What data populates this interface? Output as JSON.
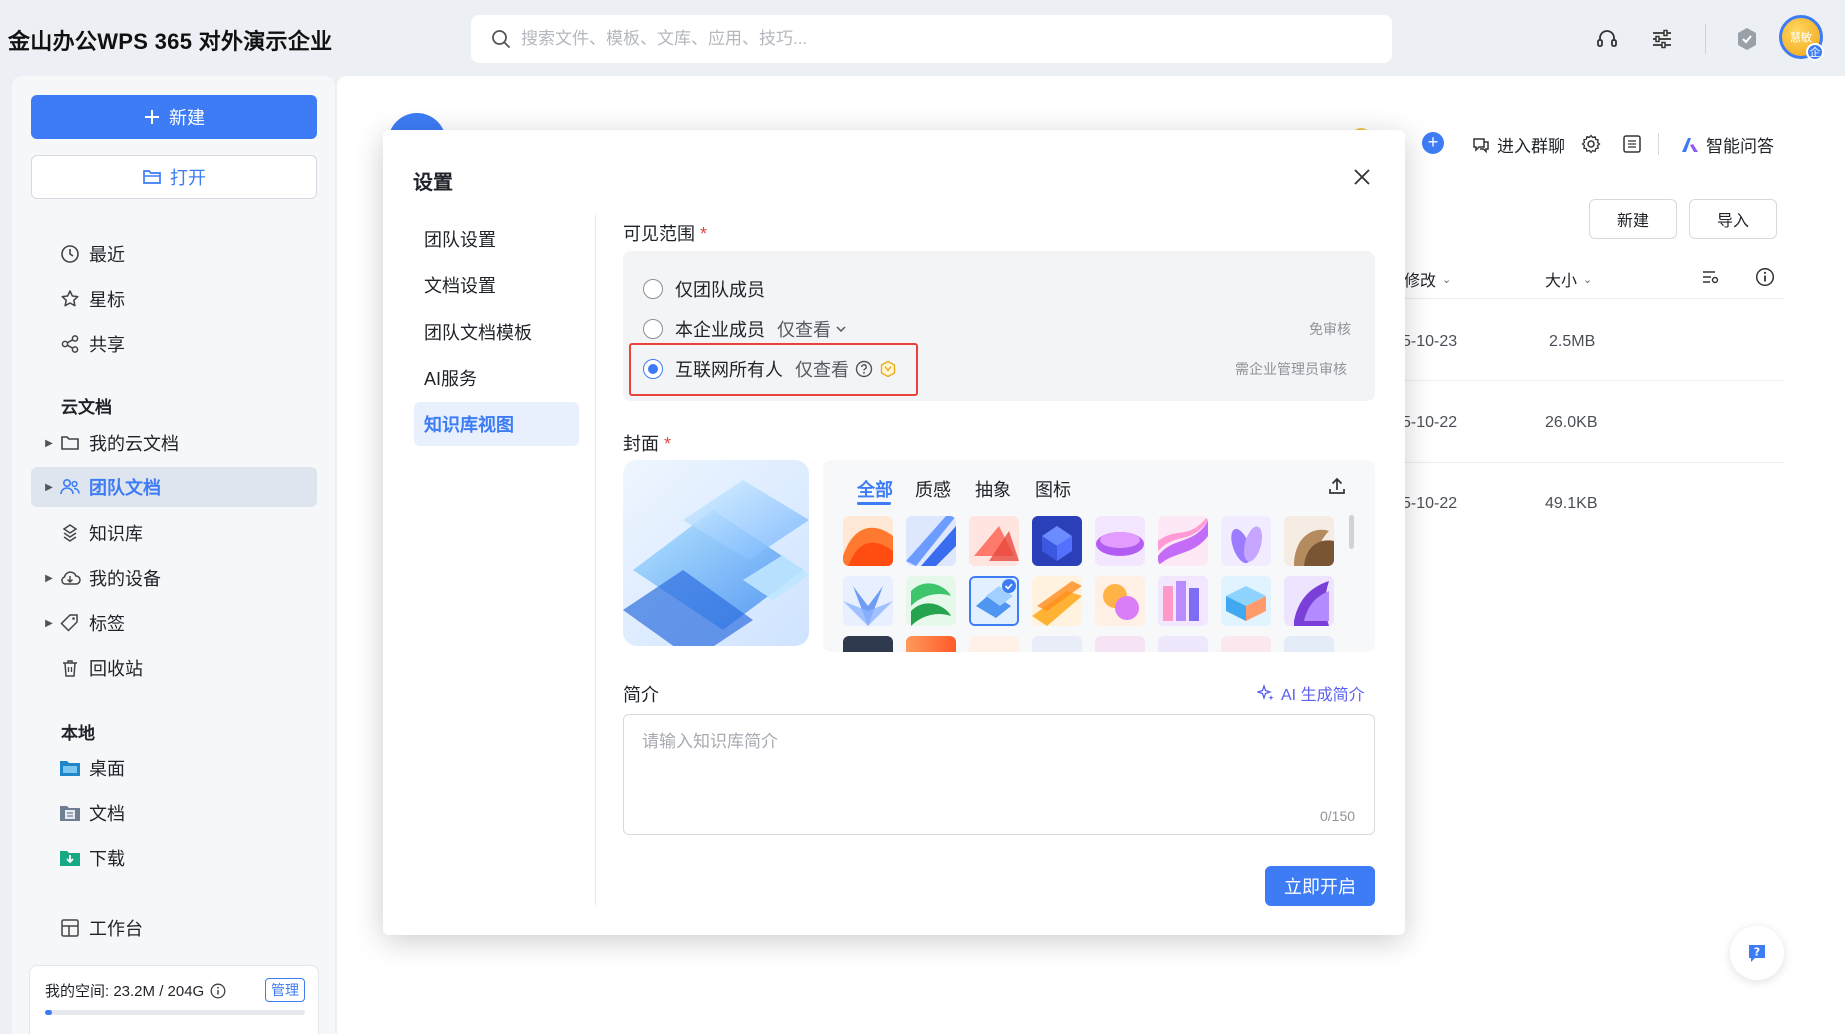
{
  "app": {
    "title": "金山办公WPS 365 对外演示企业"
  },
  "search": {
    "placeholder": "搜索文件、模板、文库、应用、技巧..."
  },
  "top": {
    "avatar_text": "慧敏",
    "avatar_badge": "企"
  },
  "sidebar": {
    "new_label": "新建",
    "open_label": "打开",
    "nav_recent": "最近",
    "nav_star": "星标",
    "nav_share": "共享",
    "section_cloud": "云文档",
    "cloud_items": [
      {
        "label": "我的云文档",
        "icon": "folder-icon"
      },
      {
        "label": "团队文档",
        "icon": "team-icon"
      },
      {
        "label": "知识库",
        "icon": "knowledge-icon"
      },
      {
        "label": "我的设备",
        "icon": "cloud-device-icon"
      },
      {
        "label": "标签",
        "icon": "tag-icon"
      },
      {
        "label": "回收站",
        "icon": "trash-icon"
      }
    ],
    "section_local": "本地",
    "local_items": [
      {
        "label": "桌面",
        "icon": "desktop-folder-icon"
      },
      {
        "label": "文档",
        "icon": "documents-folder-icon"
      },
      {
        "label": "下载",
        "icon": "download-folder-icon"
      }
    ],
    "workbench_label": "工作台",
    "storage_text": "我的空间: 23.2M / 204G",
    "manage_label": "管理",
    "storage_used_fraction": 0.0001
  },
  "main": {
    "enter_group_chat": "进入群聊",
    "smart_qa": "智能问答",
    "new_button": "新建",
    "import_button": "导入",
    "col_modified": "修改",
    "col_size": "大小",
    "rows": [
      {
        "date": "5-10-23",
        "size": "2.5MB"
      },
      {
        "date": "5-10-22",
        "size": "26.0KB"
      },
      {
        "date": "5-10-22",
        "size": "49.1KB"
      }
    ]
  },
  "modal": {
    "title": "设置",
    "nav": [
      "团队设置",
      "文档设置",
      "团队文档模板",
      "AI服务",
      "知识库视图"
    ],
    "active_nav": "知识库视图",
    "visibility_label": "可见范围",
    "required_mark": "*",
    "options": [
      {
        "label": "仅团队成员",
        "suffix": "",
        "note": "",
        "selected": false
      },
      {
        "label": "本企业成员",
        "suffix": "仅查看",
        "note": "免审核",
        "selected": false
      },
      {
        "label": "互联网所有人",
        "suffix": "仅查看",
        "note": "需企业管理员审核",
        "selected": true
      }
    ],
    "cover_label": "封面",
    "cover_tabs": [
      "全部",
      "质感",
      "抽象",
      "图标"
    ],
    "intro_label": "简介",
    "ai_generate": "AI 生成简介",
    "intro_placeholder": "请输入知识库简介",
    "intro_count": "0/150",
    "submit_label": "立即开启"
  }
}
